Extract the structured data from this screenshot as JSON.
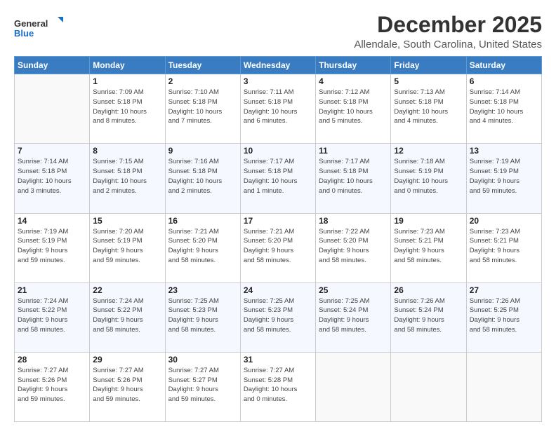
{
  "header": {
    "logo_line1": "General",
    "logo_line2": "Blue",
    "month": "December 2025",
    "location": "Allendale, South Carolina, United States"
  },
  "days_of_week": [
    "Sunday",
    "Monday",
    "Tuesday",
    "Wednesday",
    "Thursday",
    "Friday",
    "Saturday"
  ],
  "weeks": [
    [
      {
        "day": "",
        "info": ""
      },
      {
        "day": "1",
        "info": "Sunrise: 7:09 AM\nSunset: 5:18 PM\nDaylight: 10 hours\nand 8 minutes."
      },
      {
        "day": "2",
        "info": "Sunrise: 7:10 AM\nSunset: 5:18 PM\nDaylight: 10 hours\nand 7 minutes."
      },
      {
        "day": "3",
        "info": "Sunrise: 7:11 AM\nSunset: 5:18 PM\nDaylight: 10 hours\nand 6 minutes."
      },
      {
        "day": "4",
        "info": "Sunrise: 7:12 AM\nSunset: 5:18 PM\nDaylight: 10 hours\nand 5 minutes."
      },
      {
        "day": "5",
        "info": "Sunrise: 7:13 AM\nSunset: 5:18 PM\nDaylight: 10 hours\nand 4 minutes."
      },
      {
        "day": "6",
        "info": "Sunrise: 7:14 AM\nSunset: 5:18 PM\nDaylight: 10 hours\nand 4 minutes."
      }
    ],
    [
      {
        "day": "7",
        "info": "Sunrise: 7:14 AM\nSunset: 5:18 PM\nDaylight: 10 hours\nand 3 minutes."
      },
      {
        "day": "8",
        "info": "Sunrise: 7:15 AM\nSunset: 5:18 PM\nDaylight: 10 hours\nand 2 minutes."
      },
      {
        "day": "9",
        "info": "Sunrise: 7:16 AM\nSunset: 5:18 PM\nDaylight: 10 hours\nand 2 minutes."
      },
      {
        "day": "10",
        "info": "Sunrise: 7:17 AM\nSunset: 5:18 PM\nDaylight: 10 hours\nand 1 minute."
      },
      {
        "day": "11",
        "info": "Sunrise: 7:17 AM\nSunset: 5:18 PM\nDaylight: 10 hours\nand 0 minutes."
      },
      {
        "day": "12",
        "info": "Sunrise: 7:18 AM\nSunset: 5:19 PM\nDaylight: 10 hours\nand 0 minutes."
      },
      {
        "day": "13",
        "info": "Sunrise: 7:19 AM\nSunset: 5:19 PM\nDaylight: 9 hours\nand 59 minutes."
      }
    ],
    [
      {
        "day": "14",
        "info": "Sunrise: 7:19 AM\nSunset: 5:19 PM\nDaylight: 9 hours\nand 59 minutes."
      },
      {
        "day": "15",
        "info": "Sunrise: 7:20 AM\nSunset: 5:19 PM\nDaylight: 9 hours\nand 59 minutes."
      },
      {
        "day": "16",
        "info": "Sunrise: 7:21 AM\nSunset: 5:20 PM\nDaylight: 9 hours\nand 58 minutes."
      },
      {
        "day": "17",
        "info": "Sunrise: 7:21 AM\nSunset: 5:20 PM\nDaylight: 9 hours\nand 58 minutes."
      },
      {
        "day": "18",
        "info": "Sunrise: 7:22 AM\nSunset: 5:20 PM\nDaylight: 9 hours\nand 58 minutes."
      },
      {
        "day": "19",
        "info": "Sunrise: 7:23 AM\nSunset: 5:21 PM\nDaylight: 9 hours\nand 58 minutes."
      },
      {
        "day": "20",
        "info": "Sunrise: 7:23 AM\nSunset: 5:21 PM\nDaylight: 9 hours\nand 58 minutes."
      }
    ],
    [
      {
        "day": "21",
        "info": "Sunrise: 7:24 AM\nSunset: 5:22 PM\nDaylight: 9 hours\nand 58 minutes."
      },
      {
        "day": "22",
        "info": "Sunrise: 7:24 AM\nSunset: 5:22 PM\nDaylight: 9 hours\nand 58 minutes."
      },
      {
        "day": "23",
        "info": "Sunrise: 7:25 AM\nSunset: 5:23 PM\nDaylight: 9 hours\nand 58 minutes."
      },
      {
        "day": "24",
        "info": "Sunrise: 7:25 AM\nSunset: 5:23 PM\nDaylight: 9 hours\nand 58 minutes."
      },
      {
        "day": "25",
        "info": "Sunrise: 7:25 AM\nSunset: 5:24 PM\nDaylight: 9 hours\nand 58 minutes."
      },
      {
        "day": "26",
        "info": "Sunrise: 7:26 AM\nSunset: 5:24 PM\nDaylight: 9 hours\nand 58 minutes."
      },
      {
        "day": "27",
        "info": "Sunrise: 7:26 AM\nSunset: 5:25 PM\nDaylight: 9 hours\nand 58 minutes."
      }
    ],
    [
      {
        "day": "28",
        "info": "Sunrise: 7:27 AM\nSunset: 5:26 PM\nDaylight: 9 hours\nand 59 minutes."
      },
      {
        "day": "29",
        "info": "Sunrise: 7:27 AM\nSunset: 5:26 PM\nDaylight: 9 hours\nand 59 minutes."
      },
      {
        "day": "30",
        "info": "Sunrise: 7:27 AM\nSunset: 5:27 PM\nDaylight: 9 hours\nand 59 minutes."
      },
      {
        "day": "31",
        "info": "Sunrise: 7:27 AM\nSunset: 5:28 PM\nDaylight: 10 hours\nand 0 minutes."
      },
      {
        "day": "",
        "info": ""
      },
      {
        "day": "",
        "info": ""
      },
      {
        "day": "",
        "info": ""
      }
    ]
  ]
}
